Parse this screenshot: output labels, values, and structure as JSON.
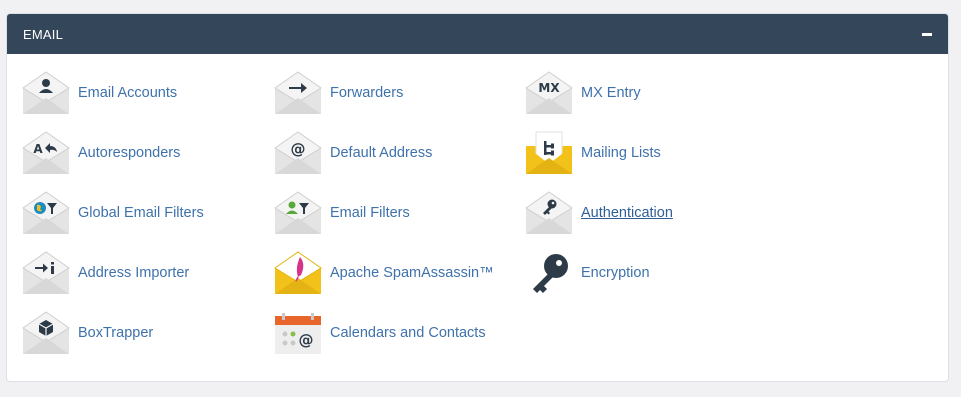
{
  "panel": {
    "title": "EMAIL",
    "collapse_icon": "minus-icon"
  },
  "colors": {
    "header_bg": "#34475a",
    "link": "#3f72ab",
    "envelope_gray": "#dcdcdc",
    "accent_yellow": "#f2c21b",
    "accent_orange": "#e8662b"
  },
  "items": [
    {
      "label": "Email Accounts",
      "icon": "user-envelope-icon"
    },
    {
      "label": "Forwarders",
      "icon": "forward-arrow-envelope-icon"
    },
    {
      "label": "MX Entry",
      "icon": "mx-envelope-icon"
    },
    {
      "label": "Autoresponders",
      "icon": "autoresponder-envelope-icon"
    },
    {
      "label": "Default Address",
      "icon": "at-sign-envelope-icon"
    },
    {
      "label": "Mailing Lists",
      "icon": "mailing-list-envelope-icon"
    },
    {
      "label": "Global Email Filters",
      "icon": "globe-filter-envelope-icon"
    },
    {
      "label": "Email Filters",
      "icon": "user-filter-envelope-icon"
    },
    {
      "label": "Authentication",
      "icon": "key-envelope-icon"
    },
    {
      "label": "Address Importer",
      "icon": "import-envelope-icon"
    },
    {
      "label": "Apache SpamAssassin™",
      "icon": "feather-envelope-icon"
    },
    {
      "label": "Encryption",
      "icon": "key-icon"
    },
    {
      "label": "BoxTrapper",
      "icon": "box-envelope-icon"
    },
    {
      "label": "Calendars and Contacts",
      "icon": "calendar-icon"
    }
  ]
}
